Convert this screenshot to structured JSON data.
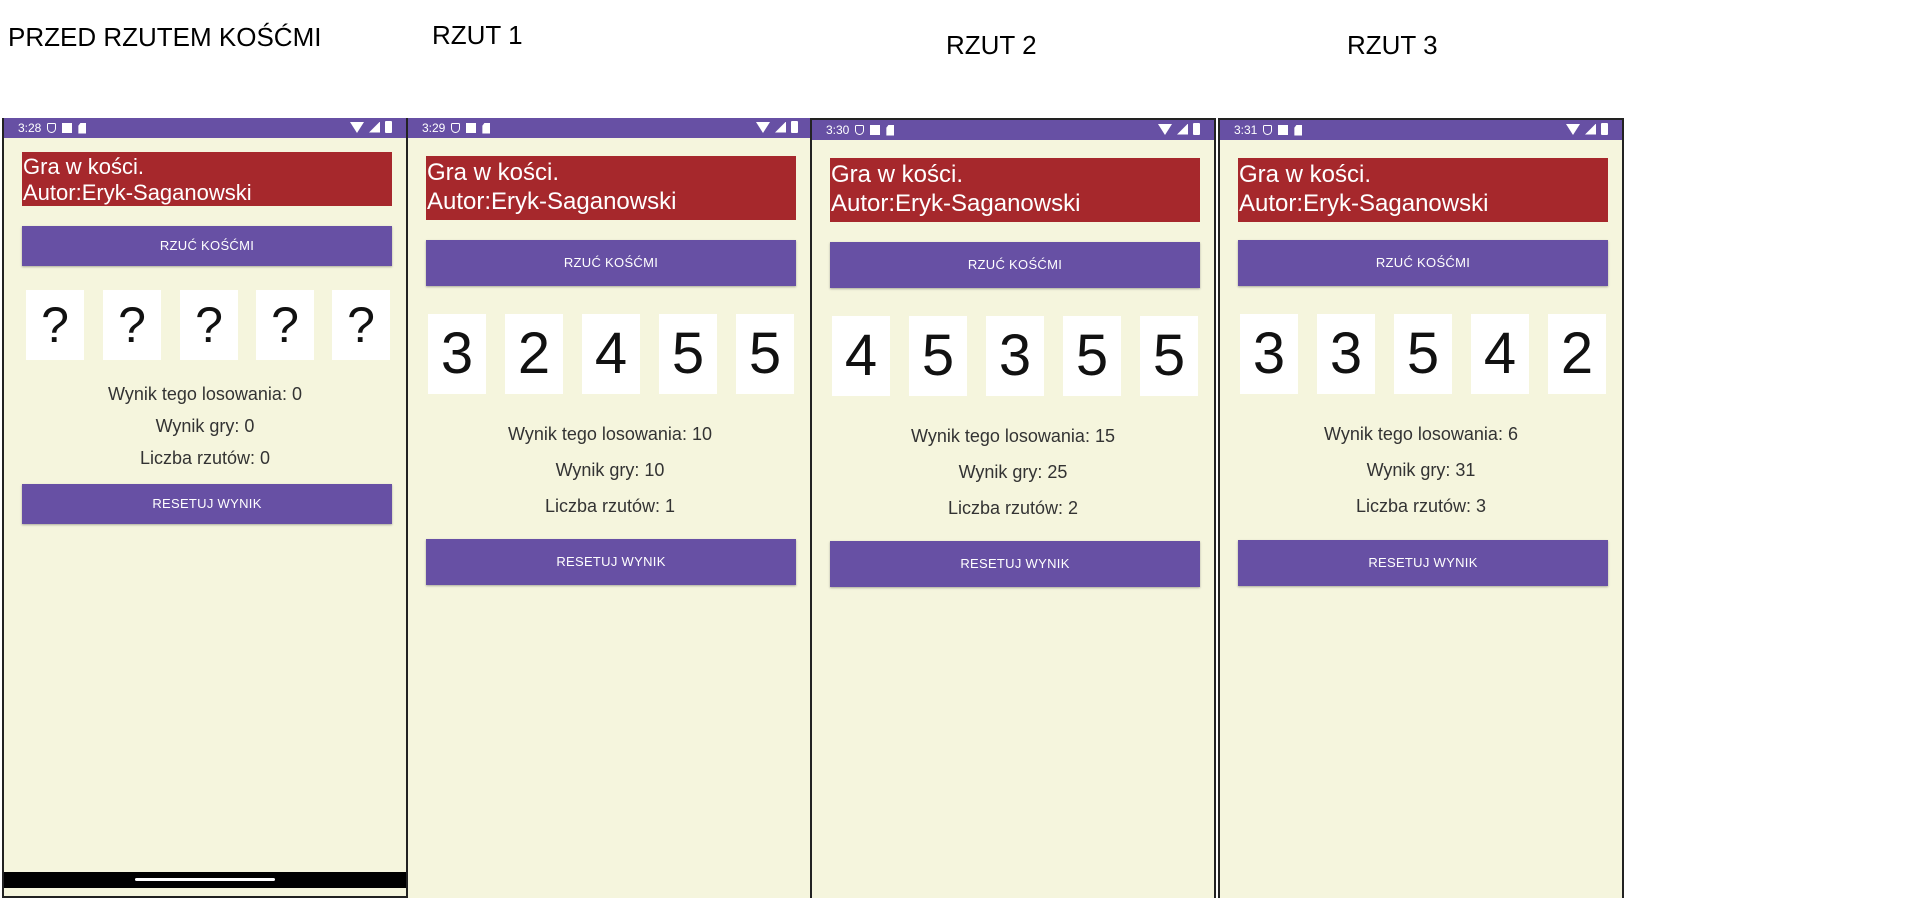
{
  "captions": [
    "PRZED RZUTEM KOŚĆMI",
    "RZUT 1",
    "RZUT 2",
    "RZUT 3"
  ],
  "colors": {
    "accent": "#6750a4",
    "header": "#a6282c",
    "background": "#f5f5dd",
    "die": "#ffffff"
  },
  "phones": [
    {
      "time": "3:28",
      "header_line1": "Gra w kości.",
      "header_line2": "Autor:Eryk-Saganowski",
      "roll_button": "RZUĆ KOŚĆMI",
      "dice": [
        "?",
        "?",
        "?",
        "?",
        "?"
      ],
      "stat_roll": "Wynik tego losowania: 0",
      "stat_game": "Wynik gry: 0",
      "stat_count": "Liczba rzutów: 0",
      "reset_button": "RESETUJ WYNIK"
    },
    {
      "time": "3:29",
      "header_line1": "Gra w kości.",
      "header_line2": "Autor:Eryk-Saganowski",
      "roll_button": "RZUĆ KOŚĆMI",
      "dice": [
        "3",
        "2",
        "4",
        "5",
        "5"
      ],
      "stat_roll": "Wynik tego losowania: 10",
      "stat_game": "Wynik gry: 10",
      "stat_count": "Liczba rzutów: 1",
      "reset_button": "RESETUJ WYNIK"
    },
    {
      "time": "3:30",
      "header_line1": "Gra w kości.",
      "header_line2": "Autor:Eryk-Saganowski",
      "roll_button": "RZUĆ KOŚĆMI",
      "dice": [
        "4",
        "5",
        "3",
        "5",
        "5"
      ],
      "stat_roll": "Wynik tego losowania: 15",
      "stat_game": "Wynik gry: 25",
      "stat_count": "Liczba rzutów: 2",
      "reset_button": "RESETUJ WYNIK"
    },
    {
      "time": "3:31",
      "header_line1": "Gra w kości.",
      "header_line2": "Autor:Eryk-Saganowski",
      "roll_button": "RZUĆ KOŚĆMI",
      "dice": [
        "3",
        "3",
        "5",
        "4",
        "2"
      ],
      "stat_roll": "Wynik tego losowania: 6",
      "stat_game": "Wynik gry: 31",
      "stat_count": "Liczba rzutów: 3",
      "reset_button": "RESETUJ WYNIK"
    }
  ]
}
